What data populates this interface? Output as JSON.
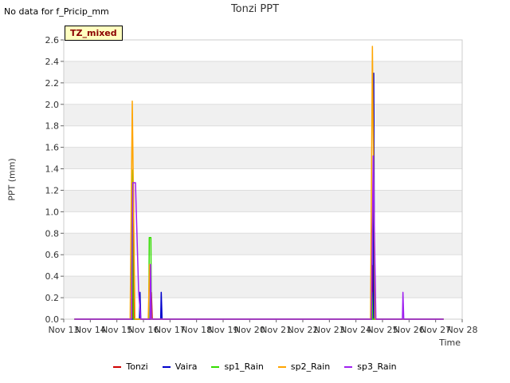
{
  "header": {
    "no_data_note": "No data for f_Pricip_mm",
    "title": "Tonzi PPT"
  },
  "badge": "TZ_mixed",
  "chart_data": {
    "type": "line",
    "title": "Tonzi PPT",
    "xlabel": "Time",
    "ylabel": "PPT (mm)",
    "xlim": [
      "Nov 13",
      "Nov 28"
    ],
    "ylim": [
      0.0,
      2.6
    ],
    "x_ticks": [
      "Nov 13",
      "Nov 14",
      "Nov 15",
      "Nov 16",
      "Nov 17",
      "Nov 18",
      "Nov 19",
      "Nov 20",
      "Nov 21",
      "Nov 22",
      "Nov 23",
      "Nov 24",
      "Nov 25",
      "Nov 26",
      "Nov 27",
      "Nov 28"
    ],
    "y_ticks": [
      "0.0",
      "0.2",
      "0.4",
      "0.6",
      "0.8",
      "1.0",
      "1.2",
      "1.4",
      "1.6",
      "1.8",
      "2.0",
      "2.2",
      "2.4",
      "2.6"
    ],
    "grid": "horizontal bands",
    "legend_position": "bottom",
    "series": [
      {
        "name": "Tonzi",
        "color": "#d00000",
        "points": [
          [
            13.4,
            0
          ],
          [
            15.6,
            0
          ],
          [
            15.62,
            1.27
          ],
          [
            15.65,
            0
          ],
          [
            16.28,
            0
          ],
          [
            16.3,
            0.25
          ],
          [
            16.33,
            0
          ],
          [
            24.6,
            0
          ],
          [
            24.62,
            0.5
          ],
          [
            24.65,
            0
          ],
          [
            27.3,
            0
          ]
        ]
      },
      {
        "name": "Vaira",
        "color": "#0000cc",
        "points": [
          [
            13.4,
            0
          ],
          [
            15.85,
            0
          ],
          [
            15.87,
            0.25
          ],
          [
            15.9,
            0
          ],
          [
            16.65,
            0
          ],
          [
            16.67,
            0.25
          ],
          [
            16.7,
            0
          ],
          [
            24.65,
            0
          ],
          [
            24.67,
            2.29
          ],
          [
            24.7,
            0
          ],
          [
            27.3,
            0
          ]
        ]
      },
      {
        "name": "sp1_Rain",
        "color": "#33dd00",
        "points": [
          [
            13.4,
            0
          ],
          [
            15.55,
            0
          ],
          [
            15.57,
            1.39
          ],
          [
            15.62,
            0
          ],
          [
            16.2,
            0
          ],
          [
            16.22,
            0.76
          ],
          [
            16.28,
            0.76
          ],
          [
            16.3,
            0
          ],
          [
            24.58,
            0
          ],
          [
            24.6,
            0.25
          ],
          [
            24.63,
            0
          ],
          [
            27.3,
            0
          ]
        ]
      },
      {
        "name": "sp2_Rain",
        "color": "#ffa500",
        "points": [
          [
            13.4,
            0
          ],
          [
            15.5,
            0
          ],
          [
            15.58,
            2.03
          ],
          [
            15.68,
            0
          ],
          [
            16.18,
            0
          ],
          [
            16.23,
            0.51
          ],
          [
            16.28,
            0
          ],
          [
            24.55,
            0
          ],
          [
            24.62,
            2.54
          ],
          [
            24.72,
            0
          ],
          [
            27.3,
            0
          ]
        ]
      },
      {
        "name": "sp3_Rain",
        "color": "#a020f0",
        "points": [
          [
            13.4,
            0
          ],
          [
            15.55,
            0
          ],
          [
            15.6,
            1.27
          ],
          [
            15.7,
            1.27
          ],
          [
            15.82,
            0.25
          ],
          [
            15.9,
            0
          ],
          [
            16.25,
            0
          ],
          [
            16.27,
            0.51
          ],
          [
            16.3,
            0
          ],
          [
            24.58,
            0
          ],
          [
            24.65,
            1.52
          ],
          [
            24.75,
            0
          ],
          [
            25.75,
            0
          ],
          [
            25.77,
            0.25
          ],
          [
            25.8,
            0
          ],
          [
            27.3,
            0
          ]
        ]
      }
    ]
  }
}
